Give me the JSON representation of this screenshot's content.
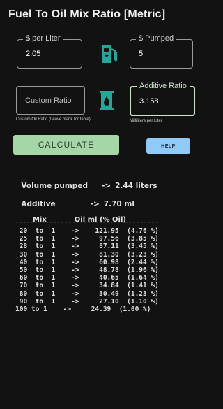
{
  "header": {
    "title": "Fuel To Oil Mix Ratio [Metric]"
  },
  "price_field": {
    "label": "$ per Liter",
    "value": "2.05"
  },
  "pumped_field": {
    "label": "$ Pumped",
    "value": "5"
  },
  "custom_ratio_field": {
    "placeholder": "Custom Ratio",
    "helper": "Custom Oil Ratio (Leave blank for table)"
  },
  "additive_field": {
    "label": "Additive Ratio",
    "value": "3.158",
    "helper": "Milliliters per Liter"
  },
  "buttons": {
    "calculate": "CALCULATE",
    "help": "HELP"
  },
  "icons": {
    "fuel": "gas-pump-icon",
    "oil": "oil-barrel-icon",
    "accent": "#a5d6a7",
    "help_color": "#90caf9",
    "icon_color": "#26a69a"
  },
  "summary": {
    "volume_label": "Volume pumped",
    "volume_arrow": "->",
    "volume_value": "2.44 liters",
    "additive_label": "Additive",
    "additive_arrow": "->",
    "additive_value": "7.70 ml"
  },
  "table": {
    "col_mix": "Mix",
    "col_oil": "Oil ml (% Oil)",
    "divider": "--------------------------------------",
    "rows": [
      " 20  to  1    ->    121.95  (4.76 %)",
      " 25  to  1    ->     97.56  (3.85 %)",
      " 28  to  1    ->     87.11  (3.45 %)",
      " 30  to  1    ->     81.30  (3.23 %)",
      " 40  to  1    ->     60.98  (2.44 %)",
      " 50  to  1    ->     48.78  (1.96 %)",
      " 60  to  1    ->     40.65  (1.64 %)",
      " 70  to  1    ->     34.84  (1.41 %)",
      " 80  to  1    ->     30.49  (1.23 %)",
      " 90  to  1    ->     27.10  (1.10 %)",
      "100 to 1    ->     24.39  (1.00 %)"
    ]
  }
}
